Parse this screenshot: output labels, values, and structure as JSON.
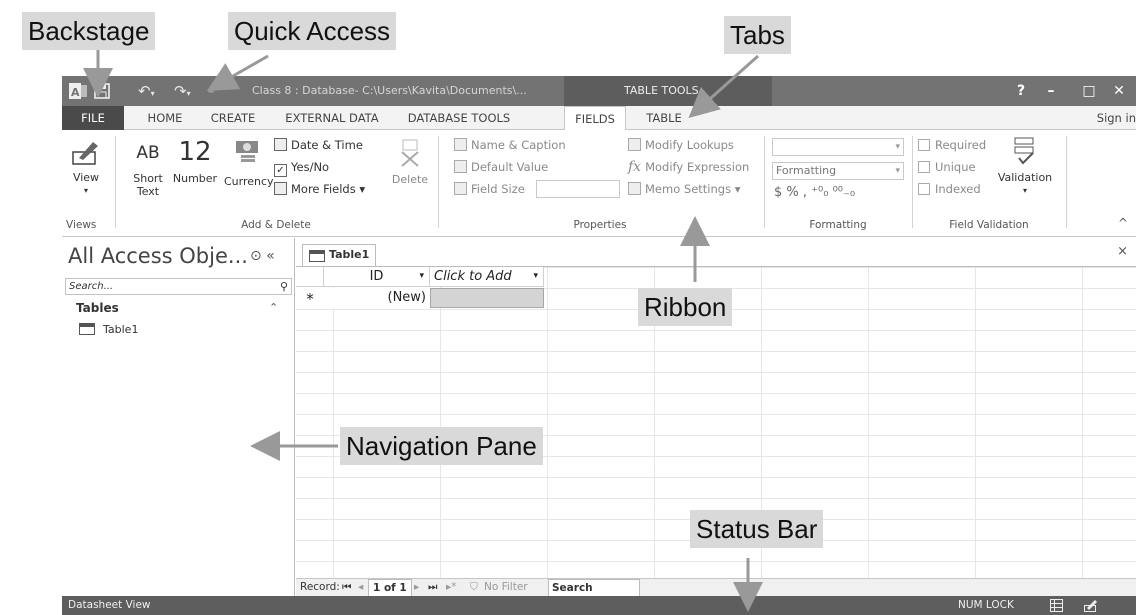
{
  "callouts": {
    "backstage": "Backstage",
    "quick_access": "Quick Access",
    "tabs": "Tabs",
    "ribbon": "Ribbon",
    "navigation_pane": "Navigation Pane",
    "status_bar": "Status Bar"
  },
  "titlebar": {
    "title": "Class 8 : Database- C:\\Users\\Kavita\\Documents\\...",
    "table_tools": "TABLE TOOLS",
    "help": "?",
    "minimize": "–",
    "restore": "□",
    "close": "✕",
    "qa_icons": [
      "access-logo-icon",
      "save-icon",
      "undo-icon",
      "redo-icon",
      "customize-icon"
    ]
  },
  "tabs": {
    "file": "FILE",
    "home": "HOME",
    "create": "CREATE",
    "external_data": "EXTERNAL DATA",
    "database_tools": "DATABASE TOOLS",
    "fields": "FIELDS",
    "table": "TABLE",
    "sign_in": "Sign in",
    "active": "FIELDS"
  },
  "ribbon": {
    "views": {
      "view": "View",
      "group": "Views"
    },
    "add_delete": {
      "short_text_line1": "Short",
      "short_text_line2": "Text",
      "short_text_icon": "AB",
      "number": "Number",
      "number_icon": "12",
      "currency": "Currency",
      "date_time": "Date & Time",
      "yes_no": "Yes/No",
      "more_fields": "More Fields ▾",
      "delete": "Delete",
      "group": "Add & Delete"
    },
    "properties": {
      "name_caption": "Name & Caption",
      "default_value": "Default Value",
      "field_size": "Field Size",
      "modify_lookups": "Modify Lookups",
      "modify_expression": "Modify Expression",
      "memo_settings": "Memo Settings ▾",
      "group": "Properties"
    },
    "formatting": {
      "data_type": "",
      "format": "Formatting",
      "currency_symbols": "$  %  ,  ⁺⁰₀  ⁰⁰₋₀",
      "group": "Formatting"
    },
    "field_validation": {
      "required": "Required",
      "unique": "Unique",
      "indexed": "Indexed",
      "validation": "Validation",
      "group": "Field Validation"
    },
    "collapse": "^"
  },
  "navpane": {
    "title": "All Access Obje...",
    "controls": "⊙ «",
    "search_placeholder": "Search...",
    "group": "Tables",
    "collapse": "⌃",
    "items": [
      "Table1"
    ]
  },
  "document": {
    "tab": "Table1",
    "close": "×",
    "columns": [
      "ID",
      "Click to Add"
    ],
    "new_row_marker": "*",
    "new_row_value": "(New)"
  },
  "record_nav": {
    "label": "Record:",
    "first": "⏮",
    "prev": "◂",
    "position": "1 of 1",
    "next": "▸",
    "last": "⏭",
    "new": "▸*",
    "no_filter": "No Filter",
    "search": "Search"
  },
  "statusbar": {
    "mode": "Datasheet View",
    "num_lock": "NUM LOCK"
  }
}
